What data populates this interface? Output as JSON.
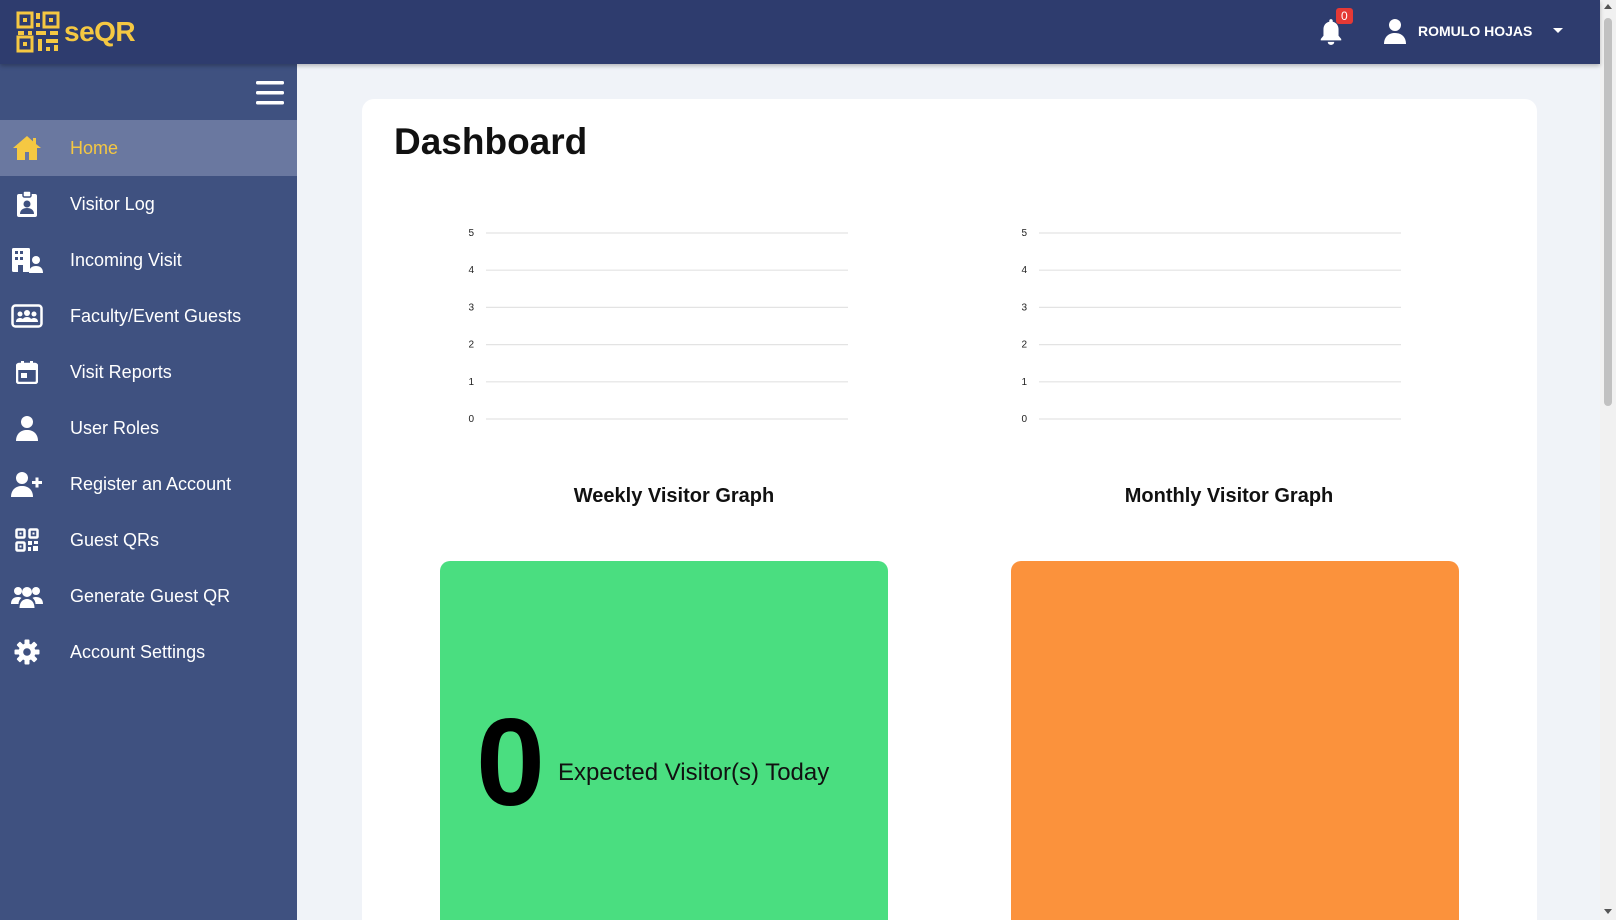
{
  "app": {
    "name": "seQR"
  },
  "header": {
    "notification_count": "0",
    "user_name": "ROMULO HOJAS"
  },
  "sidebar": {
    "items": [
      {
        "label": "Home",
        "icon": "home-icon",
        "active": true
      },
      {
        "label": "Visitor Log",
        "icon": "clipboard-user-icon"
      },
      {
        "label": "Incoming Visit",
        "icon": "building-user-icon"
      },
      {
        "label": "Faculty/Event Guests",
        "icon": "rectangle-users-icon"
      },
      {
        "label": "Visit Reports",
        "icon": "calendar-icon"
      },
      {
        "label": "User Roles",
        "icon": "user-icon"
      },
      {
        "label": "Register an Account",
        "icon": "user-plus-icon"
      },
      {
        "label": "Guest QRs",
        "icon": "qrcode-icon"
      },
      {
        "label": "Generate Guest QR",
        "icon": "users-icon"
      },
      {
        "label": "Account Settings",
        "icon": "gear-icon"
      }
    ]
  },
  "main": {
    "title": "Dashboard",
    "stats": {
      "expected_count": "0",
      "expected_label": "Expected Visitor(s) Today"
    }
  },
  "colors": {
    "header": "#2e3c6e",
    "sidebar": "#3f5180",
    "sidebar_active": "#6a78a0",
    "accent_yellow": "#f5c842",
    "stat_green": "#4ade80",
    "stat_orange": "#fb923c"
  },
  "chart_data": [
    {
      "type": "line",
      "title": "Weekly Visitor Graph",
      "yticks": [
        0,
        1,
        2,
        3,
        4,
        5
      ],
      "ylim": [
        0,
        5
      ],
      "series": []
    },
    {
      "type": "line",
      "title": "Monthly Visitor Graph",
      "yticks": [
        0,
        1,
        2,
        3,
        4,
        5
      ],
      "ylim": [
        0,
        5
      ],
      "series": []
    }
  ]
}
